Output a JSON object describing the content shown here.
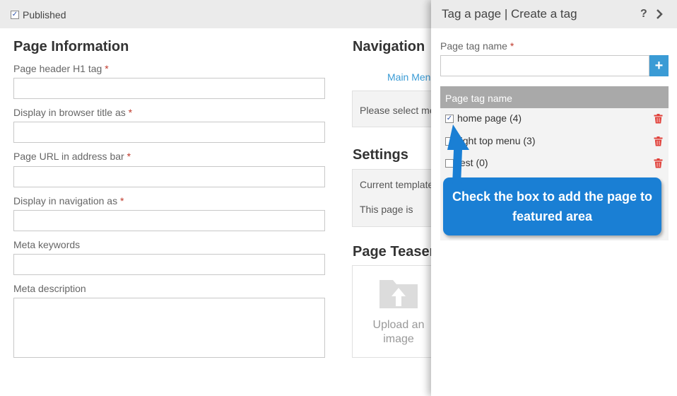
{
  "topbar": {
    "published_label": "Published",
    "published_checked": true
  },
  "page_info": {
    "title": "Page Information",
    "fields": [
      {
        "label": "Page header H1 tag",
        "required": "*",
        "value": ""
      },
      {
        "label": "Display in browser title as",
        "required": "*",
        "value": ""
      },
      {
        "label": "Page URL in address bar",
        "required": "*",
        "value": ""
      },
      {
        "label": "Display in navigation as",
        "required": "*",
        "value": ""
      },
      {
        "label": "Meta keywords",
        "value": ""
      },
      {
        "label": "Meta description",
        "value": ""
      }
    ]
  },
  "navigation": {
    "title": "Navigation",
    "menu_link": "Main Menu",
    "select_text": "Please select menu"
  },
  "settings": {
    "title": "Settings",
    "template_text": "Current template",
    "page_is_text": "This page is"
  },
  "teaser": {
    "title": "Page Teaser",
    "upload_line1": "Upload an",
    "upload_line2": "image"
  },
  "panel": {
    "title": "Tag a page | Create a tag",
    "help_icon": "?",
    "tag_name_label": "Page tag name",
    "required": "*",
    "tag_name_value": "",
    "add_button": "+",
    "table_header": "Page tag name",
    "tags": [
      {
        "label": "home page (4)",
        "checked": true
      },
      {
        "label": "right top menu (3)",
        "checked": false
      },
      {
        "label": "test (0)",
        "checked": false
      }
    ]
  },
  "callout": {
    "text": "Check the box to add the page to featured area"
  },
  "colors": {
    "accent": "#3a9bd5",
    "callout": "#1a7fd4",
    "trash": "#e0403a",
    "required": "#c0392b",
    "table_header": "#a9a9a9"
  }
}
